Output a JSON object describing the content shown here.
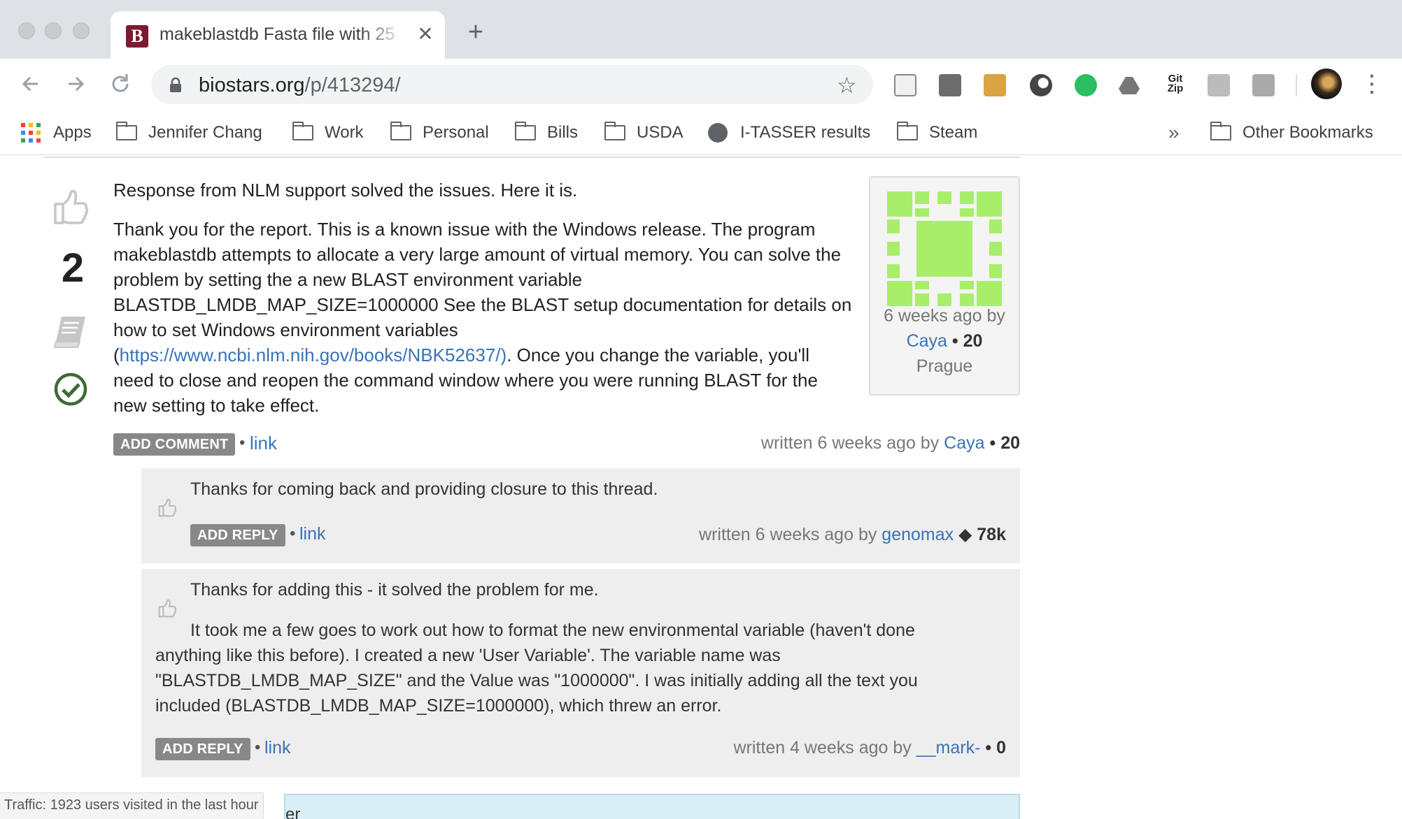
{
  "browser": {
    "tab_title": "makeblastdb Fasta file with 25",
    "tab_favicon_letter": "B",
    "url_host": "biostars.org",
    "url_path": "/p/413294/",
    "bookmarks": [
      "Apps",
      "Jennifer Chang",
      "Work",
      "Personal",
      "Bills",
      "USDA",
      "I-TASSER results",
      "Steam"
    ],
    "bookmarks_overflow": "»",
    "other_bookmarks": "Other Bookmarks",
    "extension_icons": [
      "document-icon",
      "notebook-icon",
      "doge-icon",
      "circle-icon",
      "evernote-icon",
      "drive-icon",
      "gitzip-icon",
      "hypothesis-icon",
      "bi-icon"
    ],
    "gitzip_label": "Git Zip",
    "close_glyph": "✕",
    "new_tab_glyph": "+"
  },
  "answer": {
    "vote_count": "2",
    "intro": "Response from NLM support solved the issues. Here it is.",
    "lines": [
      "Thank you for the report. This is a known issue with the Windows release. The program",
      "makeblastdb attempts to allocate a very large amount of virtual memory. You can solve the",
      "problem by setting the a new BLAST environment variable",
      "BLASTDB_LMDB_MAP_SIZE=1000000 See the BLAST setup documentation for details on",
      "how to set Windows environment variables"
    ],
    "link_prefix": "(",
    "link_text": "https://www.ncbi.nlm.nih.gov/books/NBK52637/)",
    "after_link": ". Once you change the variable, you'll",
    "lines_end": [
      "need to close and reopen the command window where you were running BLAST for the",
      "new setting to take effect."
    ],
    "card": {
      "ago": "6 weeks ago by",
      "user": "Caya",
      "sep": " • ",
      "rep": "20",
      "location": "Prague"
    },
    "add_comment": "ADD COMMENT",
    "bullet": "•",
    "link": "link",
    "written_prefix": "written 6 weeks ago by ",
    "written_user": "Caya",
    "written_sep": " • ",
    "written_rep": "20"
  },
  "comments": [
    {
      "text": "Thanks for coming back and providing closure to this thread.",
      "button": "ADD REPLY",
      "link": "link",
      "written_prefix": "written 6 weeks ago by ",
      "user": "genomax",
      "sep": " ◆ ",
      "rep": "78k"
    },
    {
      "text": "Thanks for adding this - it solved the problem for me.",
      "para": [
        "It took me a few goes to work out how to format the new environmental variable (haven't done",
        "anything like this before). I created a new 'User Variable'. The variable name was",
        "\"BLASTDB_LMDB_MAP_SIZE\" and the Value was \"1000000\". I was initially adding all the text you",
        "included (BLASTDB_LMDB_MAP_SIZE=1000000), which threw an error."
      ],
      "button": "ADD REPLY",
      "link": "link",
      "written_prefix": "written 4 weeks ago by ",
      "user": "__mark-",
      "sep": " • ",
      "rep": "0"
    }
  ],
  "footer": {
    "traffic": "Traffic: 1923 users visited in the last hour",
    "next_box_text": "er"
  },
  "colors": {
    "link": "#3873b8",
    "avatar": "#a8ee6a",
    "button": "#888888"
  }
}
